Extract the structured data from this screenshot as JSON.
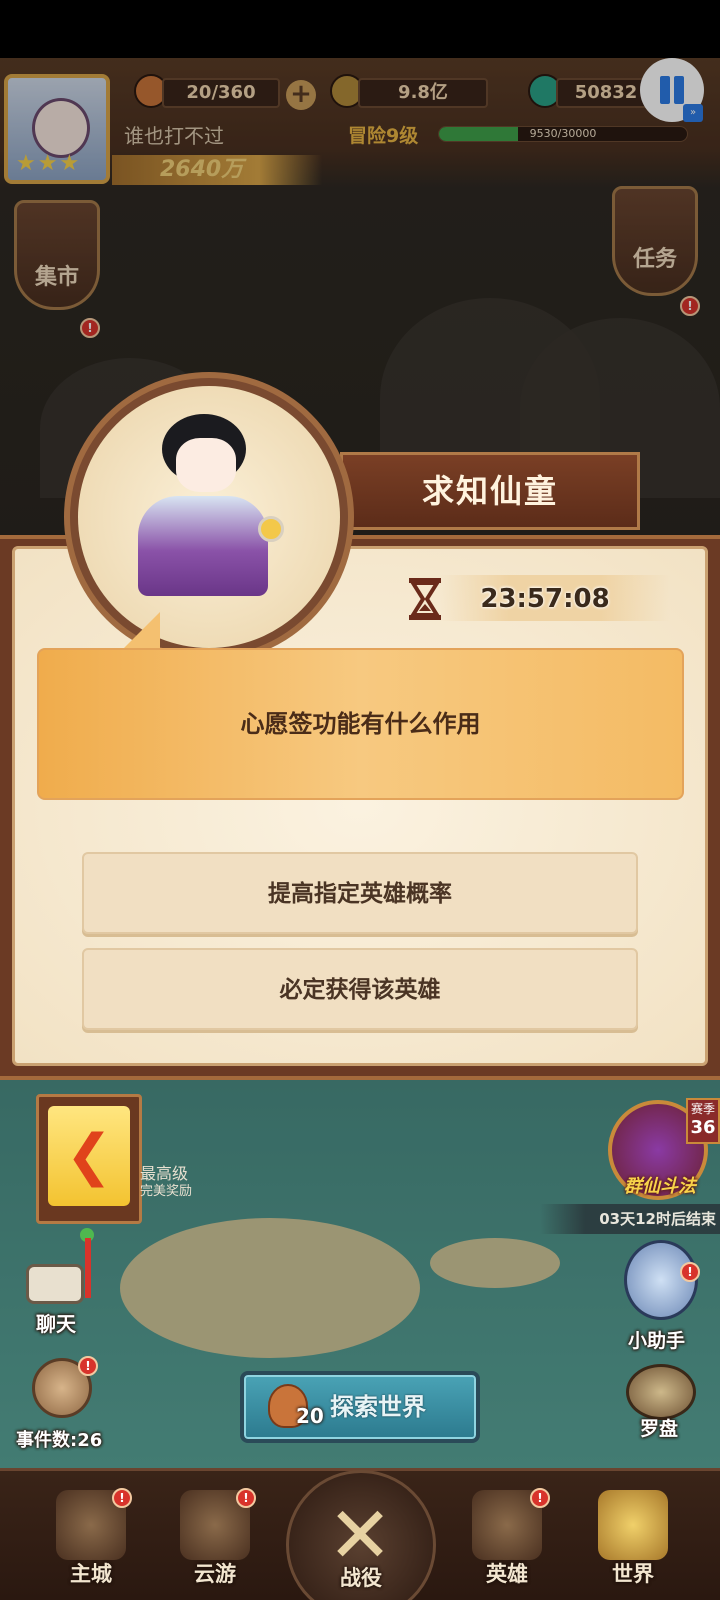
{
  "hud": {
    "stamina": "20/360",
    "coins": "9.8亿",
    "jade": "50832",
    "player_name": "谁也打不过",
    "adventure_level": "冒险9级",
    "xp_text": "9530/30000",
    "xp_progress": 0.3177,
    "combat_power": "2640万"
  },
  "side": {
    "market_label": "集市",
    "tasks_label": "任务"
  },
  "dialog": {
    "npc_name": "求知仙童",
    "timer": "23:57:08",
    "question": "心愿签功能有什么作用",
    "answers": [
      "提高指定英雄概率",
      "必定获得该英雄"
    ]
  },
  "map": {
    "event_line1": "最高级",
    "event_line2": "完美奖励",
    "chat_label": "聊天",
    "event_count": "事件数:26",
    "pvp_title": "群仙斗法",
    "season_label": "赛季",
    "season_number": "36",
    "countdown": "03天12时后结束",
    "helper_label": "小助手",
    "compass_label": "罗盘",
    "explore_cost": "20",
    "explore_label": "探索世界"
  },
  "nav": {
    "items": [
      "主城",
      "云游",
      "战役",
      "英雄",
      "世界"
    ]
  },
  "colors": {
    "dialog_frame": "#6b3a24",
    "question_bg": "#f4bb64",
    "answer_bg": "#f1dfc2",
    "explore_btn": "#2c7a8e",
    "alert_dot": "#d8332b",
    "pause_blue": "#2d7be5"
  }
}
